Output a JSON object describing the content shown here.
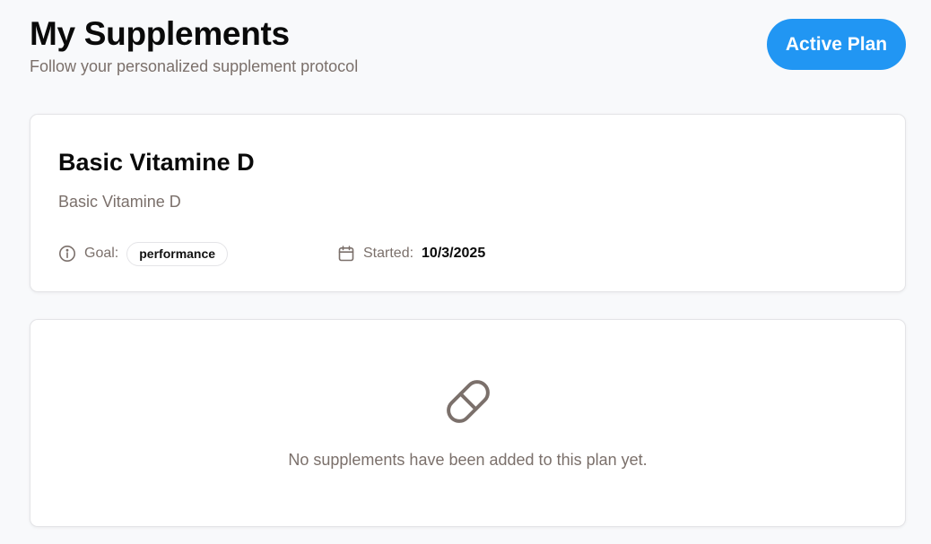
{
  "header": {
    "title": "My Supplements",
    "subtitle": "Follow your personalized supplement protocol",
    "status_label": "Active Plan"
  },
  "plan": {
    "name": "Basic Vitamine D",
    "description": "Basic Vitamine D",
    "goal_label": "Goal:",
    "goal_value": "performance",
    "started_label": "Started:",
    "started_value": "10/3/2025"
  },
  "supplements": {
    "empty_message": "No supplements have been added to this plan yet."
  },
  "icons": {
    "goal": "info-icon",
    "started": "calendar-icon",
    "empty": "pill-icon"
  },
  "colors": {
    "accent": "#2196f3",
    "muted_text": "#7b706b",
    "background": "#f8f9fb"
  }
}
